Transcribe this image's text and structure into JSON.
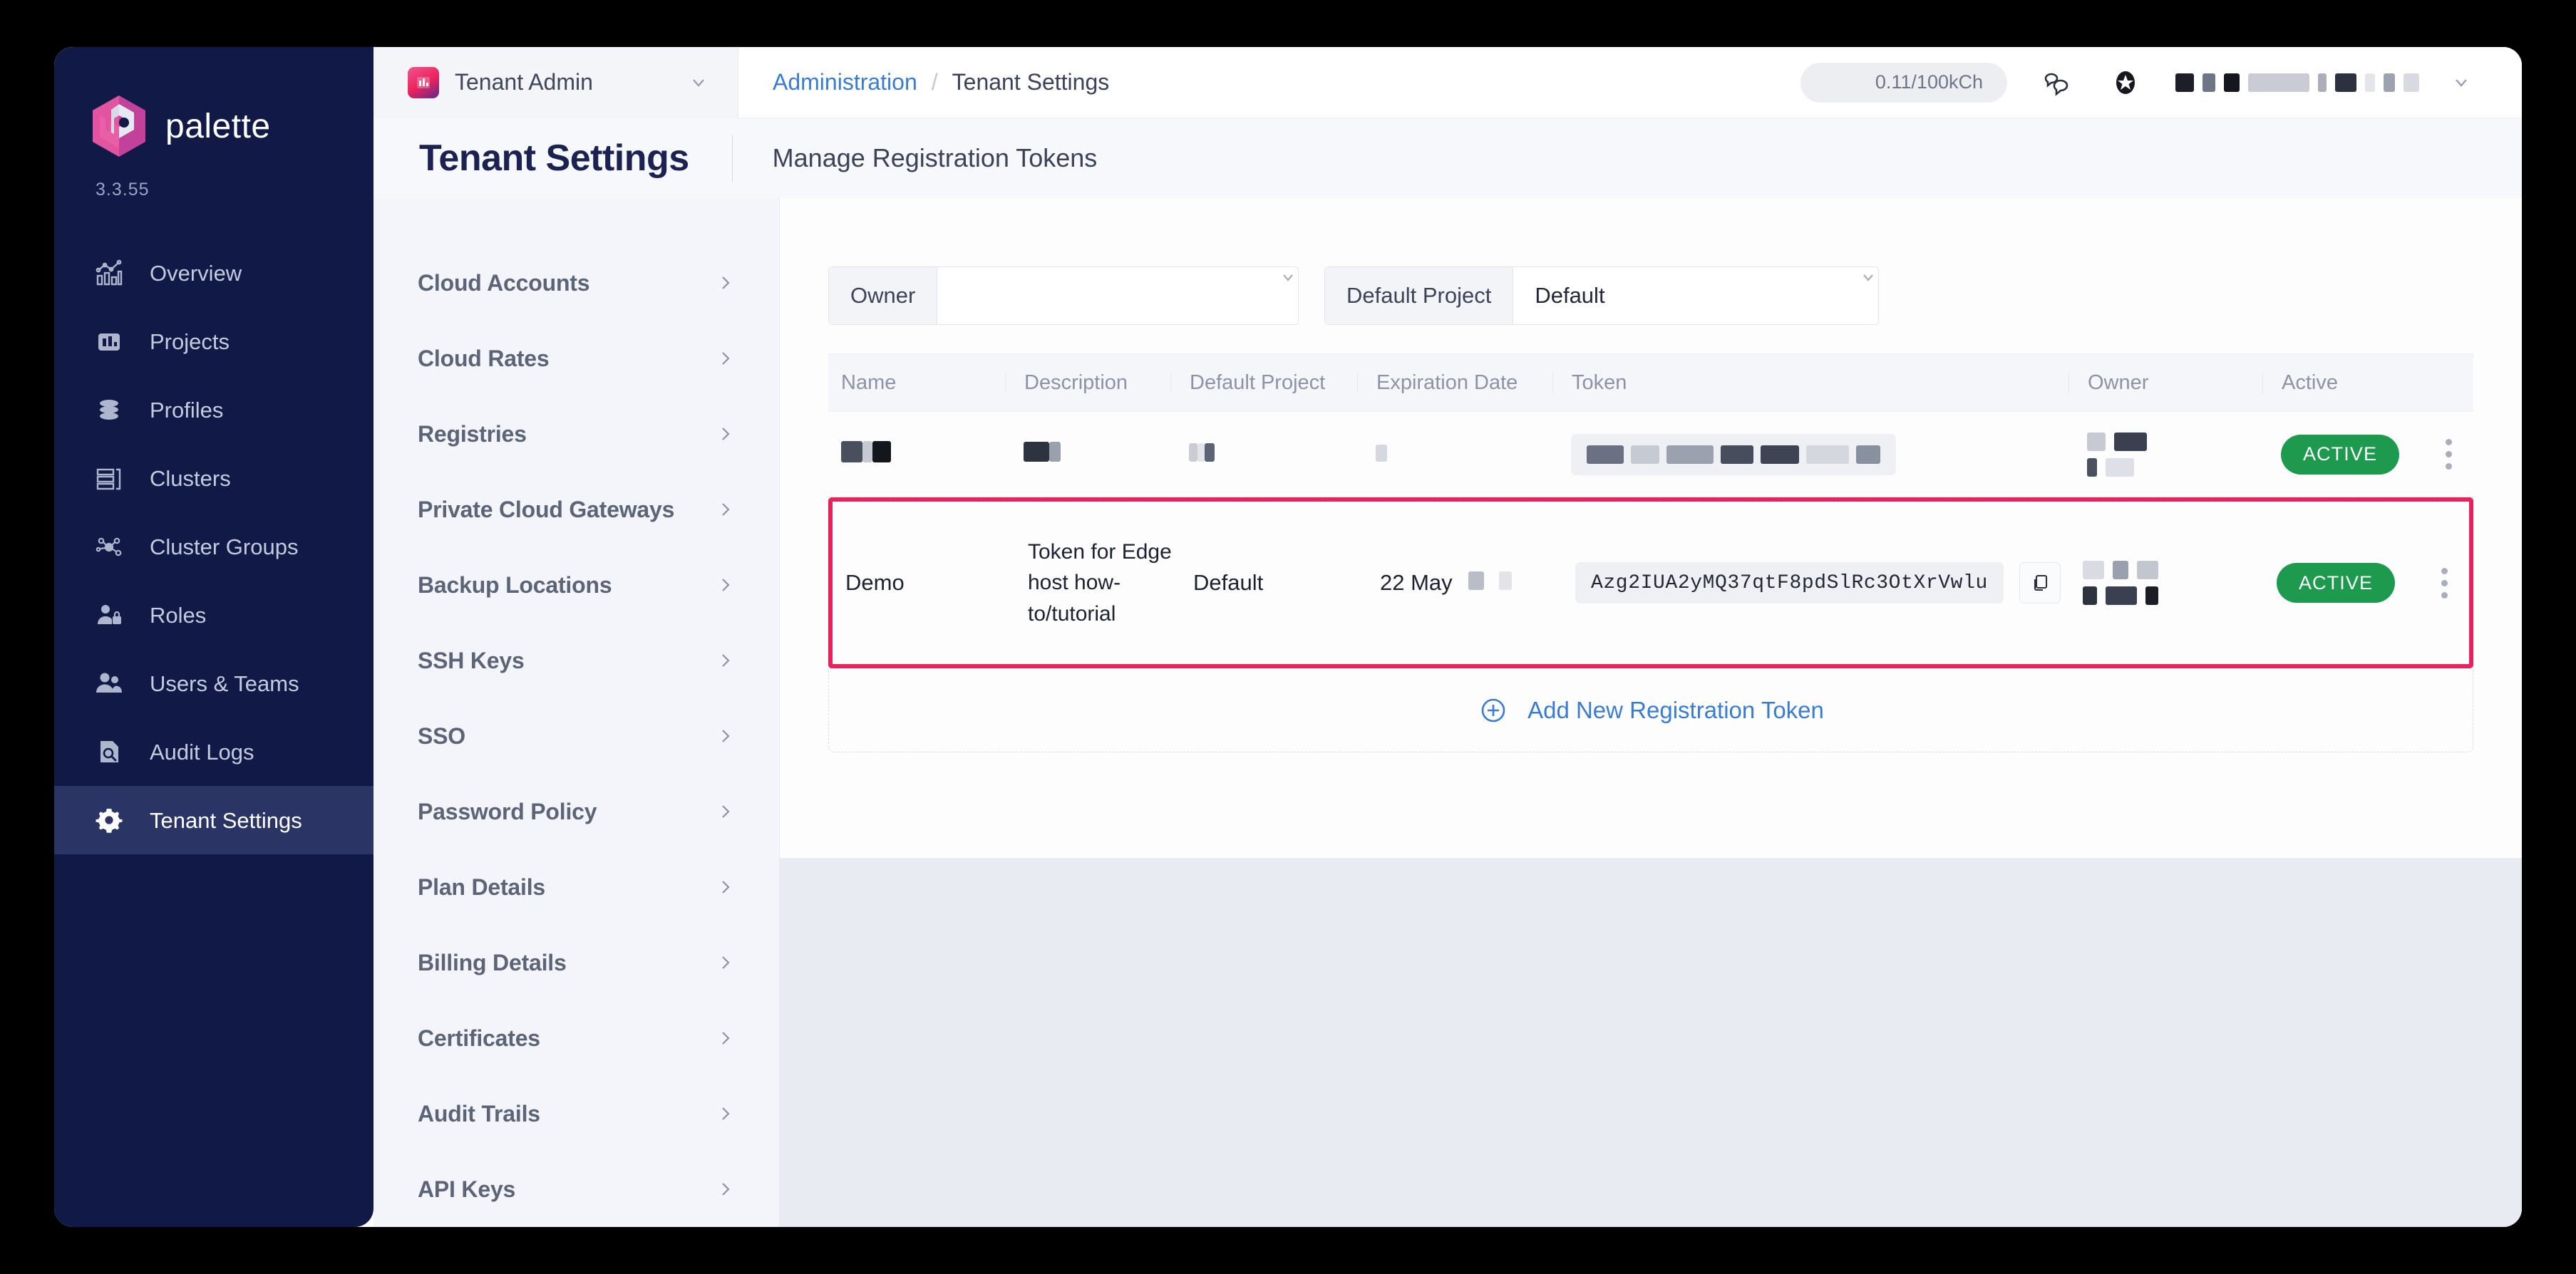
{
  "brand": {
    "name": "palette",
    "version": "3.3.55",
    "logo_icon": "palette-hexagon-logo"
  },
  "sidebar": {
    "items": [
      {
        "label": "Overview",
        "icon": "chart-overview-icon",
        "active": false
      },
      {
        "label": "Projects",
        "icon": "projects-bar-icon",
        "active": false
      },
      {
        "label": "Profiles",
        "icon": "layers-stack-icon",
        "active": false
      },
      {
        "label": "Clusters",
        "icon": "server-rack-icon",
        "active": false
      },
      {
        "label": "Cluster Groups",
        "icon": "network-nodes-icon",
        "active": false
      },
      {
        "label": "Roles",
        "icon": "user-lock-icon",
        "active": false
      },
      {
        "label": "Users & Teams",
        "icon": "users-group-icon",
        "active": false
      },
      {
        "label": "Audit Logs",
        "icon": "document-search-icon",
        "active": false
      },
      {
        "label": "Tenant Settings",
        "icon": "gear-icon",
        "active": true
      }
    ]
  },
  "topbar": {
    "tenant_switcher": {
      "label": "Tenant Admin",
      "icon": "tenant-badge-icon",
      "caret_icon": "chevron-down-icon"
    },
    "breadcrumb": {
      "parent": "Administration",
      "separator": "/",
      "current": "Tenant Settings"
    },
    "credit_pill": "0.11/100kCh",
    "chat_icon": "chat-bubbles-icon",
    "star_icon": "star-badge-icon",
    "user_caret_icon": "chevron-down-icon"
  },
  "page": {
    "title": "Tenant Settings",
    "section_title": "Manage Registration Tokens"
  },
  "settings_nav": {
    "items": [
      {
        "label": "Cloud Accounts"
      },
      {
        "label": "Cloud Rates"
      },
      {
        "label": "Registries"
      },
      {
        "label": "Private Cloud Gateways"
      },
      {
        "label": "Backup Locations"
      },
      {
        "label": "SSH Keys"
      },
      {
        "label": "SSO"
      },
      {
        "label": "Password Policy"
      },
      {
        "label": "Plan Details"
      },
      {
        "label": "Billing Details"
      },
      {
        "label": "Certificates"
      },
      {
        "label": "Audit Trails"
      },
      {
        "label": "API Keys"
      }
    ],
    "chevron_icon": "chevron-right-icon"
  },
  "filters": {
    "owner": {
      "label": "Owner",
      "value": "",
      "placeholder": "",
      "caret_icon": "chevron-down-icon"
    },
    "project": {
      "label": "Default Project",
      "value": "Default",
      "caret_icon": "chevron-down-icon"
    }
  },
  "table": {
    "columns": [
      "Name",
      "Description",
      "Default Project",
      "Expiration Date",
      "Token",
      "Owner",
      "Active"
    ],
    "rows": [
      {
        "name": "",
        "description": "",
        "default_project": "",
        "expiration_date": "",
        "token": "",
        "owner": "",
        "status": "ACTIVE",
        "redacted": true,
        "highlighted": false,
        "copy_icon": "copy-icon",
        "menu_icon": "kebab-menu-icon"
      },
      {
        "name": "Demo",
        "description": "Token for Edge host how-to/tutorial",
        "default_project": "Default",
        "expiration_date": "22 May",
        "token": "Azg2IUA2yMQ37qtF8pdSlRc3OtXrVwlu",
        "owner": "",
        "status": "ACTIVE",
        "redacted": false,
        "highlighted": true,
        "copy_icon": "copy-icon",
        "menu_icon": "kebab-menu-icon"
      }
    ]
  },
  "add_token": {
    "label": "Add New Registration Token",
    "icon": "plus-circle-icon"
  },
  "colors": {
    "sidebar_bg": "#111A46",
    "sidebar_active": "#2A3566",
    "brand_pink": "#E8225C",
    "link_blue": "#3B7CD3",
    "active_green": "#1D9A4E",
    "highlight_border": "#E8225C",
    "page_bg": "#E8ECF2"
  }
}
